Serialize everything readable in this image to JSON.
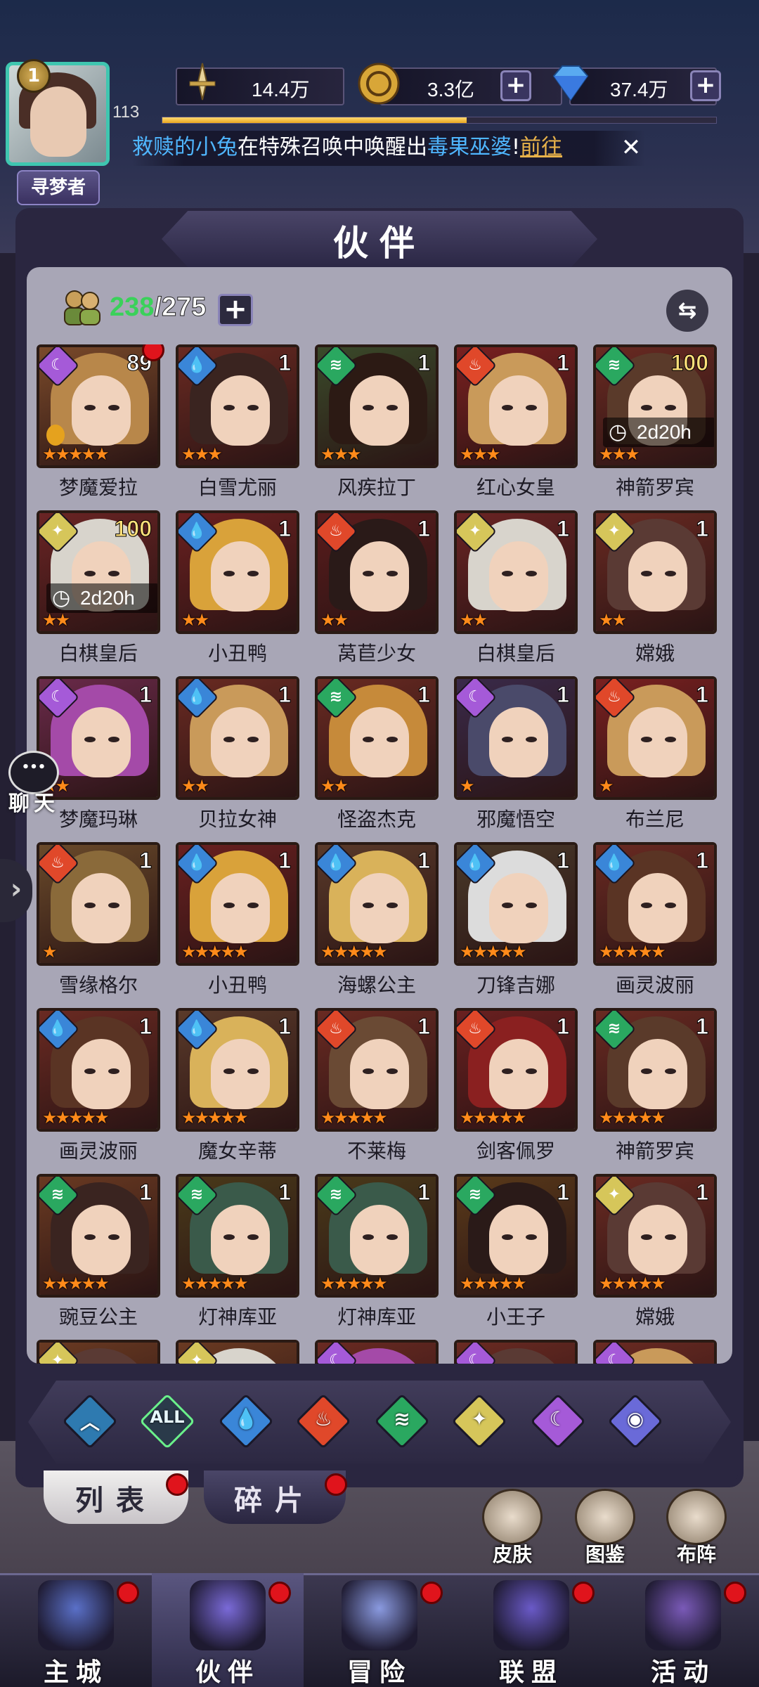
{
  "header": {
    "player_level": "1",
    "player_level_label": "113",
    "title_badge": "寻梦者",
    "resources": [
      {
        "icon": "sword-icon",
        "value": "14.4万"
      },
      {
        "icon": "gold-coin-icon",
        "value": "3.3亿"
      },
      {
        "icon": "diamond-icon",
        "value": "37.4万"
      }
    ],
    "xp_progress_fraction": 0.55,
    "ticker": {
      "part1": "救赎的小兔",
      "part2": "在特殊召唤中唤醒出",
      "part3": "毒果巫婆",
      "part4": "!",
      "part5": "前往"
    }
  },
  "panel": {
    "title": "伙伴",
    "count_current": "238",
    "count_total": "/275"
  },
  "heroes": [
    {
      "name": "梦魔爱拉",
      "level": "89",
      "element": "dark",
      "stars": "★★★★★",
      "reddot": true,
      "badge": true,
      "hair": "#b8874a",
      "bg": "#7a4a2a"
    },
    {
      "name": "白雪尤丽",
      "level": "1",
      "element": "water",
      "stars": "★★★",
      "hair": "#3a2420",
      "bg": "#6a2a22"
    },
    {
      "name": "风疾拉丁",
      "level": "1",
      "element": "wind",
      "stars": "★★★",
      "hair": "#2c1a14",
      "bg": "#3a4a2a"
    },
    {
      "name": "红心女皇",
      "level": "1",
      "element": "fire",
      "stars": "★★★",
      "hair": "#c99a5a",
      "bg": "#7a2020"
    },
    {
      "name": "神箭罗宾",
      "level": "100",
      "element": "wind",
      "stars": "★★★",
      "timer": "2d20h",
      "hair": "#5a3a2a",
      "bg": "#6a2a22"
    },
    {
      "name": "白棋皇后",
      "level": "100",
      "element": "light",
      "stars": "★★",
      "timer": "2d20h",
      "hair": "#d8d4cc",
      "bg": "#6a2424"
    },
    {
      "name": "小丑鸭",
      "level": "1",
      "element": "water",
      "stars": "★★",
      "hair": "#d9a23a",
      "bg": "#6a2020"
    },
    {
      "name": "莴苣少女",
      "level": "1",
      "element": "fire",
      "stars": "★★",
      "hair": "#2a1a18",
      "bg": "#5a1c1c"
    },
    {
      "name": "白棋皇后",
      "level": "1",
      "element": "light",
      "stars": "★★",
      "hair": "#d8d4cc",
      "bg": "#6a2424"
    },
    {
      "name": "嫦娥",
      "level": "1",
      "element": "light",
      "stars": "★★",
      "hair": "#5a3a34",
      "bg": "#6a2a22"
    },
    {
      "name": "梦魔玛琳",
      "level": "1",
      "element": "dark",
      "stars": "★★",
      "hair": "#a44aa8",
      "bg": "#6a2a4a"
    },
    {
      "name": "贝拉女神",
      "level": "1",
      "element": "water",
      "stars": "★★",
      "hair": "#c99a5a",
      "bg": "#6a2a22"
    },
    {
      "name": "怪盗杰克",
      "level": "1",
      "element": "wind",
      "stars": "★★",
      "hair": "#c68a3a",
      "bg": "#6a2a22"
    },
    {
      "name": "邪魔悟空",
      "level": "1",
      "element": "dark",
      "stars": "★",
      "hair": "#4a4a6a",
      "bg": "#3a2a4a"
    },
    {
      "name": "布兰尼",
      "level": "1",
      "element": "fire",
      "stars": "★",
      "hair": "#c99a5a",
      "bg": "#7a2020"
    },
    {
      "name": "雪缘格尔",
      "level": "1",
      "element": "fire",
      "stars": "★",
      "hair": "#8a6a3a",
      "bg": "#6a4a2a"
    },
    {
      "name": "小丑鸭",
      "level": "1",
      "element": "water",
      "stars": "★★★★★",
      "hair": "#d9a23a",
      "bg": "#6a2020"
    },
    {
      "name": "海螺公主",
      "level": "1",
      "element": "water",
      "stars": "★★★★★",
      "hair": "#d9b25a",
      "bg": "#5a3a2a"
    },
    {
      "name": "刀锋吉娜",
      "level": "1",
      "element": "water",
      "stars": "★★★★★",
      "hair": "#dcdcdc",
      "bg": "#4a3a2a"
    },
    {
      "name": "画灵波丽",
      "level": "1",
      "element": "water",
      "stars": "★★★★★",
      "hair": "#5a3424",
      "bg": "#6a2a22"
    },
    {
      "name": "画灵波丽",
      "level": "1",
      "element": "water",
      "stars": "★★★★★",
      "hair": "#5a3424",
      "bg": "#6a2a22"
    },
    {
      "name": "魔女辛蒂",
      "level": "1",
      "element": "water",
      "stars": "★★★★★",
      "hair": "#d9b25a",
      "bg": "#5a3a2a"
    },
    {
      "name": "不莱梅",
      "level": "1",
      "element": "fire",
      "stars": "★★★★★",
      "hair": "#6a4a34",
      "bg": "#6a2a22"
    },
    {
      "name": "剑客佩罗",
      "level": "1",
      "element": "fire",
      "stars": "★★★★★",
      "hair": "#8a2020",
      "bg": "#6a2020"
    },
    {
      "name": "神箭罗宾",
      "level": "1",
      "element": "wind",
      "stars": "★★★★★",
      "hair": "#5a3a2a",
      "bg": "#6a2a22"
    },
    {
      "name": "豌豆公主",
      "level": "1",
      "element": "wind",
      "stars": "★★★★★",
      "hair": "#3a2420",
      "bg": "#6a3a22"
    },
    {
      "name": "灯神库亚",
      "level": "1",
      "element": "wind",
      "stars": "★★★★★",
      "hair": "#3a5a4a",
      "bg": "#4a3a1a"
    },
    {
      "name": "灯神库亚",
      "level": "1",
      "element": "wind",
      "stars": "★★★★★",
      "hair": "#3a5a4a",
      "bg": "#4a3a1a"
    },
    {
      "name": "小王子",
      "level": "1",
      "element": "wind",
      "stars": "★★★★★",
      "hair": "#2a1a18",
      "bg": "#5a3a1a"
    },
    {
      "name": "嫦娥",
      "level": "1",
      "element": "light",
      "stars": "★★★★★",
      "hair": "#5a3a34",
      "bg": "#6a2a22"
    },
    {
      "name": "",
      "level": "",
      "element": "light",
      "stars": "",
      "hair": "#5a3a34",
      "bg": "#6a3a22"
    },
    {
      "name": "",
      "level": "",
      "element": "light",
      "stars": "",
      "hair": "#d8d4cc",
      "bg": "#6a3a22"
    },
    {
      "name": "",
      "level": "",
      "element": "dark",
      "stars": "",
      "hair": "#a44aa8",
      "bg": "#6a2a22"
    },
    {
      "name": "",
      "level": "",
      "element": "dark",
      "stars": "",
      "hair": "#5a3a34",
      "bg": "#6a2a22"
    },
    {
      "name": "",
      "level": "",
      "element": "dark",
      "stars": "",
      "hair": "#c99a5a",
      "bg": "#6a2a22"
    }
  ],
  "element_colors": {
    "dark": "#a55ad8",
    "water": "#3a86d8",
    "wind": "#2aa860",
    "fire": "#e0482a",
    "light": "#d6c65a"
  },
  "element_symbols": {
    "dark": "☾",
    "water": "💧",
    "wind": "≋",
    "fire": "♨",
    "light": "✦"
  },
  "filters": [
    {
      "id": "up",
      "symbol": "︿",
      "color": "#2e7ab0"
    },
    {
      "id": "all",
      "symbol": "ALL",
      "color": "#2a3a4a"
    },
    {
      "id": "water",
      "symbol": "💧",
      "color": "#3a86d8"
    },
    {
      "id": "fire",
      "symbol": "♨",
      "color": "#e0482a"
    },
    {
      "id": "wind",
      "symbol": "≋",
      "color": "#2aa860"
    },
    {
      "id": "light",
      "symbol": "✦",
      "color": "#d6c65a"
    },
    {
      "id": "dark",
      "symbol": "☾",
      "color": "#a55ad8"
    },
    {
      "id": "void",
      "symbol": "◉",
      "color": "#6a6ad8"
    }
  ],
  "tabs": {
    "list": "列表",
    "fragments": "碎片"
  },
  "quick_buttons": {
    "skins": "皮肤",
    "codex": "图鉴",
    "formation": "布阵"
  },
  "chat": {
    "label": "聊天"
  },
  "nav": [
    {
      "label": "主城",
      "color": "#5a70c8"
    },
    {
      "label": "伙伴",
      "color": "#7a6ad8"
    },
    {
      "label": "冒险",
      "color": "#8a9ae0"
    },
    {
      "label": "联盟",
      "color": "#6a5ac8"
    },
    {
      "label": "活动",
      "color": "#7a5ab8"
    }
  ]
}
